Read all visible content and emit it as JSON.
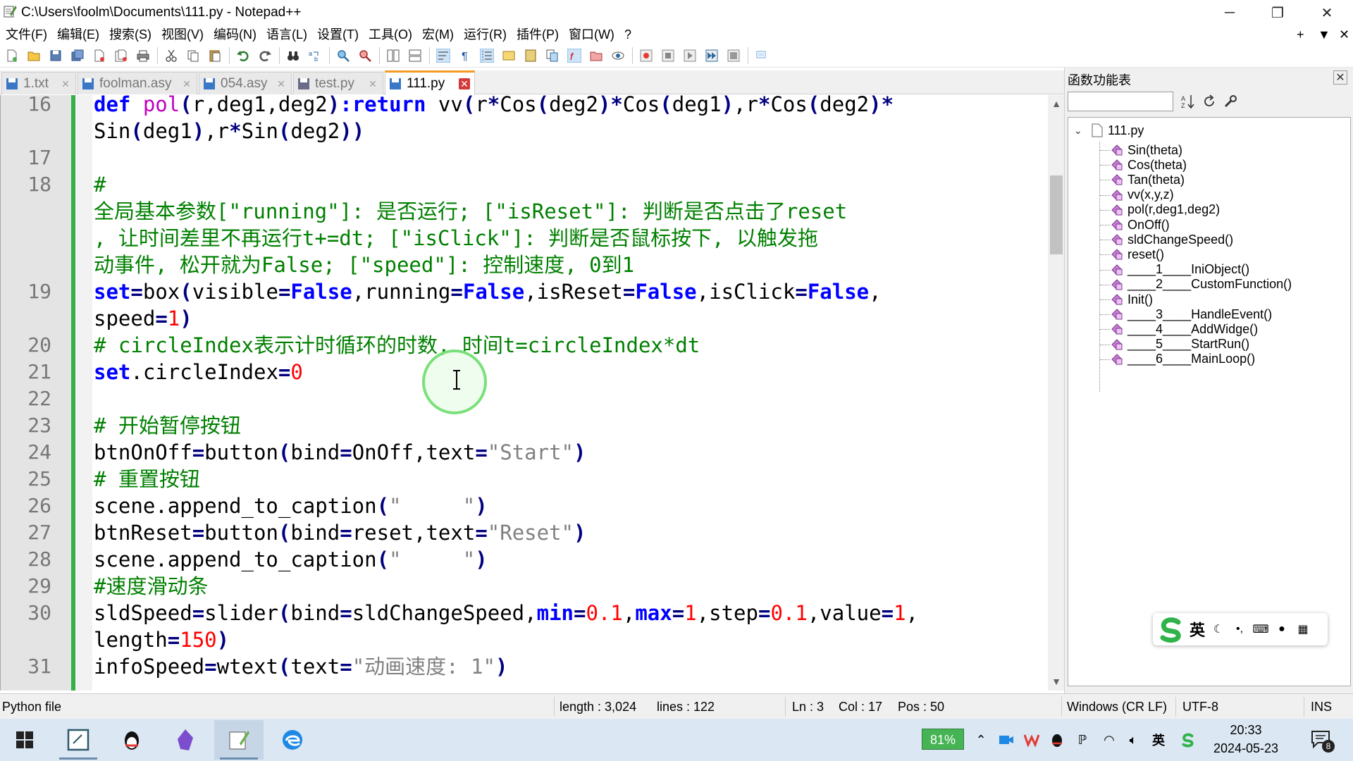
{
  "window": {
    "title": "C:\\Users\\foolm\\Documents\\111.py - Notepad++",
    "minimize": "─",
    "restore": "❐",
    "close": "✕"
  },
  "menu": {
    "items": [
      "文件(F)",
      "编辑(E)",
      "搜索(S)",
      "视图(V)",
      "编码(N)",
      "语言(L)",
      "设置(T)",
      "工具(O)",
      "宏(M)",
      "运行(R)",
      "插件(P)",
      "窗口(W)",
      "?"
    ],
    "right_plus": "+",
    "right_down": "▼",
    "right_close": "✕"
  },
  "tabs": [
    {
      "label": "1.txt",
      "active": false
    },
    {
      "label": "foolman.asy",
      "active": false
    },
    {
      "label": "054.asy",
      "active": false
    },
    {
      "label": "test.py",
      "active": false
    },
    {
      "label": "111.py",
      "active": true
    }
  ],
  "tab_close_glyph": "✕",
  "editor": {
    "line_numbers": [
      {
        "n": "16",
        "row": 0
      },
      {
        "n": "17",
        "row": 2
      },
      {
        "n": "18",
        "row": 3
      },
      {
        "n": "19",
        "row": 7
      },
      {
        "n": "20",
        "row": 9
      },
      {
        "n": "21",
        "row": 10
      },
      {
        "n": "22",
        "row": 11
      },
      {
        "n": "23",
        "row": 12
      },
      {
        "n": "24",
        "row": 13
      },
      {
        "n": "25",
        "row": 14
      },
      {
        "n": "26",
        "row": 15
      },
      {
        "n": "27",
        "row": 16
      },
      {
        "n": "28",
        "row": 17
      },
      {
        "n": "29",
        "row": 18
      },
      {
        "n": "30",
        "row": 19
      },
      {
        "n": "31",
        "row": 21
      }
    ],
    "rows": [
      [
        [
          "kw",
          "def "
        ],
        [
          "fn",
          "pol"
        ],
        [
          "op",
          "("
        ],
        [
          "",
          "r,deg1,deg2"
        ],
        [
          "op",
          ")"
        ],
        [
          "kw",
          ":return "
        ],
        [
          "",
          "vv"
        ],
        [
          "op",
          "("
        ],
        [
          "",
          "r"
        ],
        [
          "op",
          "*"
        ],
        [
          "",
          "Cos"
        ],
        [
          "op",
          "("
        ],
        [
          "",
          "deg2"
        ],
        [
          "op",
          ")*"
        ],
        [
          "",
          "Cos"
        ],
        [
          "op",
          "("
        ],
        [
          "",
          "deg1"
        ],
        [
          "op",
          ")"
        ],
        [
          "",
          ",r"
        ],
        [
          "op",
          "*"
        ],
        [
          "",
          "Cos"
        ],
        [
          "op",
          "("
        ],
        [
          "",
          "deg2"
        ],
        [
          "op",
          ")*"
        ]
      ],
      [
        [
          "",
          "Sin"
        ],
        [
          "op",
          "("
        ],
        [
          "",
          "deg1"
        ],
        [
          "op",
          ")"
        ],
        [
          "",
          ",r"
        ],
        [
          "op",
          "*"
        ],
        [
          "",
          "Sin"
        ],
        [
          "op",
          "("
        ],
        [
          "",
          "deg2"
        ],
        [
          "op",
          "))"
        ]
      ],
      [],
      [
        [
          "cmt",
          "#"
        ]
      ],
      [
        [
          "cmt",
          "全局基本参数[\"running\"]: 是否运行; [\"isReset\"]: 判断是否点击了reset"
        ]
      ],
      [
        [
          "cmt",
          ", 让时间差里不再运行t+=dt; [\"isClick\"]: 判断是否鼠标按下, 以触发拖"
        ]
      ],
      [
        [
          "cmt",
          "动事件, 松开就为False; [\"speed\"]: 控制速度, 0到1"
        ]
      ],
      [
        [
          "kw",
          "set"
        ],
        [
          "op",
          "="
        ],
        [
          "",
          "box"
        ],
        [
          "op",
          "("
        ],
        [
          "",
          "visible"
        ],
        [
          "op",
          "="
        ],
        [
          "kw",
          "False"
        ],
        [
          "",
          ",running"
        ],
        [
          "op",
          "="
        ],
        [
          "kw",
          "False"
        ],
        [
          "",
          ",isReset"
        ],
        [
          "op",
          "="
        ],
        [
          "kw",
          "False"
        ],
        [
          "",
          ",isClick"
        ],
        [
          "op",
          "="
        ],
        [
          "kw",
          "False"
        ],
        [
          "",
          ","
        ]
      ],
      [
        [
          "",
          "speed"
        ],
        [
          "op",
          "="
        ],
        [
          "num",
          "1"
        ],
        [
          "op",
          ")"
        ]
      ],
      [
        [
          "cmt",
          "# circleIndex表示计时循环的时数, 时间t=circleIndex*dt"
        ]
      ],
      [
        [
          "kw",
          "set"
        ],
        [
          "",
          ".circleIndex"
        ],
        [
          "op",
          "="
        ],
        [
          "num",
          "0"
        ]
      ],
      [],
      [
        [
          "cmt",
          "# 开始暂停按钮"
        ]
      ],
      [
        [
          "",
          "btnOnOff"
        ],
        [
          "op",
          "="
        ],
        [
          "",
          "button"
        ],
        [
          "op",
          "("
        ],
        [
          "",
          "bind"
        ],
        [
          "op",
          "="
        ],
        [
          "",
          "OnOff,text"
        ],
        [
          "op",
          "="
        ],
        [
          "str",
          "\"Start\""
        ],
        [
          "op",
          ")"
        ]
      ],
      [
        [
          "cmt",
          "# 重置按钮"
        ]
      ],
      [
        [
          "",
          "scene.append_to_caption"
        ],
        [
          "op",
          "("
        ],
        [
          "str",
          "\"     \""
        ],
        [
          "op",
          ")"
        ]
      ],
      [
        [
          "",
          "btnReset"
        ],
        [
          "op",
          "="
        ],
        [
          "",
          "button"
        ],
        [
          "op",
          "("
        ],
        [
          "",
          "bind"
        ],
        [
          "op",
          "="
        ],
        [
          "",
          "reset,text"
        ],
        [
          "op",
          "="
        ],
        [
          "str",
          "\"Reset\""
        ],
        [
          "op",
          ")"
        ]
      ],
      [
        [
          "",
          "scene.append_to_caption"
        ],
        [
          "op",
          "("
        ],
        [
          "str",
          "\"     \""
        ],
        [
          "op",
          ")"
        ]
      ],
      [
        [
          "cmt",
          "#速度滑动条"
        ]
      ],
      [
        [
          "",
          "sldSpeed"
        ],
        [
          "op",
          "="
        ],
        [
          "",
          "slider"
        ],
        [
          "op",
          "("
        ],
        [
          "",
          "bind"
        ],
        [
          "op",
          "="
        ],
        [
          "",
          "sldChangeSpeed,"
        ],
        [
          "kw",
          "min"
        ],
        [
          "op",
          "="
        ],
        [
          "num",
          "0.1"
        ],
        [
          "",
          ","
        ],
        [
          "kw",
          "max"
        ],
        [
          "op",
          "="
        ],
        [
          "num",
          "1"
        ],
        [
          "",
          ",step"
        ],
        [
          "op",
          "="
        ],
        [
          "num",
          "0.1"
        ],
        [
          "",
          ",value"
        ],
        [
          "op",
          "="
        ],
        [
          "num",
          "1"
        ],
        [
          "",
          ","
        ]
      ],
      [
        [
          "",
          "length"
        ],
        [
          "op",
          "="
        ],
        [
          "num",
          "150"
        ],
        [
          "op",
          ")"
        ]
      ],
      [
        [
          "",
          "infoSpeed"
        ],
        [
          "op",
          "="
        ],
        [
          "",
          "wtext"
        ],
        [
          "op",
          "("
        ],
        [
          "",
          "text"
        ],
        [
          "op",
          "="
        ],
        [
          "str",
          "\"动画速度: 1\""
        ],
        [
          "op",
          ")"
        ]
      ]
    ]
  },
  "function_panel": {
    "title": "函数功能表",
    "close": "✕",
    "search_value": "",
    "root": "111.py",
    "items": [
      "Sin(theta)",
      "Cos(theta)",
      "Tan(theta)",
      "vv(x,y,z)",
      "pol(r,deg1,deg2)",
      "OnOff()",
      "sldChangeSpeed()",
      "reset()",
      "____1____IniObject()",
      "____2____CustomFunction()",
      "Init()",
      "____3____HandleEvent()",
      "____4____AddWidge()",
      "____5____StartRun()",
      "____6____MainLoop()"
    ]
  },
  "ime": {
    "lang": "英"
  },
  "status": {
    "filetype": "Python file",
    "length": "length : 3,024",
    "lines": "lines : 122",
    "ln": "Ln : 3",
    "col": "Col : 17",
    "pos": "Pos : 50",
    "eol": "Windows (CR LF)",
    "encoding": "UTF-8",
    "mode": "INS"
  },
  "taskbar": {
    "battery": "81%",
    "time": "20:33",
    "date": "2024-05-23",
    "notifications": "8",
    "tray_lang": "英"
  },
  "colors": {
    "keyword": "#0000ff",
    "function": "#c000c0",
    "comment": "#008000",
    "string": "#808080",
    "number": "#ff0000",
    "fold_bar": "#35b14b",
    "active_tab_accent": "#f59a23"
  }
}
